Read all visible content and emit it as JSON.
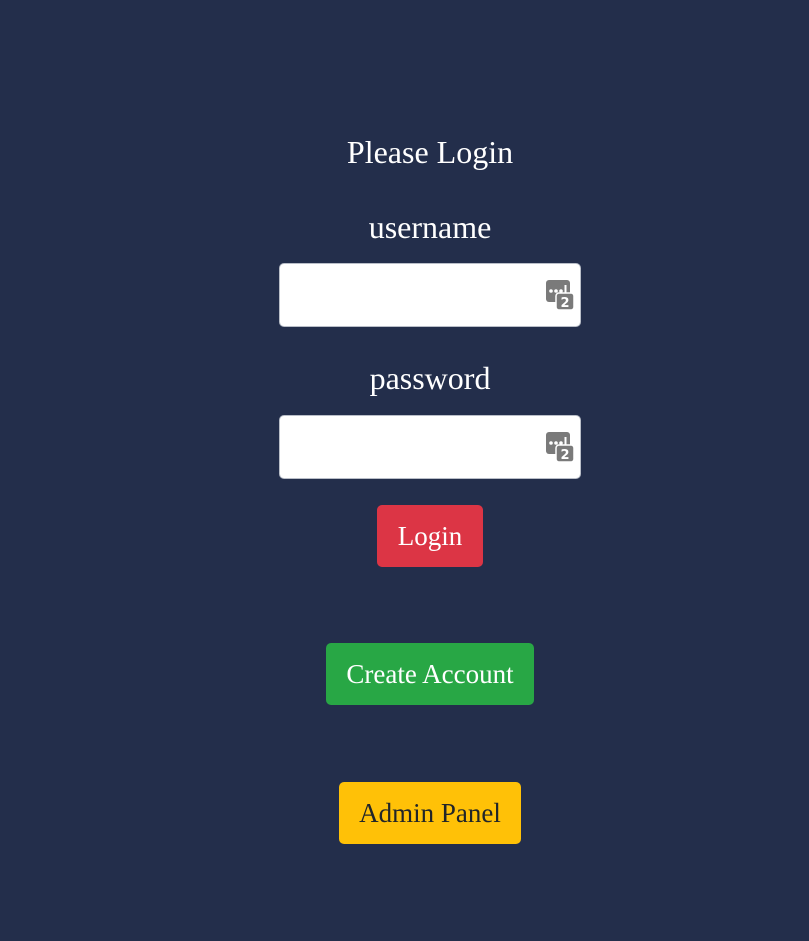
{
  "login_form": {
    "title": "Please Login",
    "username_label": "username",
    "username_value": "",
    "password_label": "password",
    "password_value": "",
    "login_button": "Login"
  },
  "actions": {
    "create_account_button": "Create Account",
    "admin_panel_button": "Admin Panel"
  },
  "icons": {
    "password_manager": "password-manager-key-icon",
    "badge_count": "2"
  },
  "colors": {
    "background": "#232e4b",
    "login": "#dc3545",
    "create_account": "#28a745",
    "admin_panel": "#ffc107"
  }
}
